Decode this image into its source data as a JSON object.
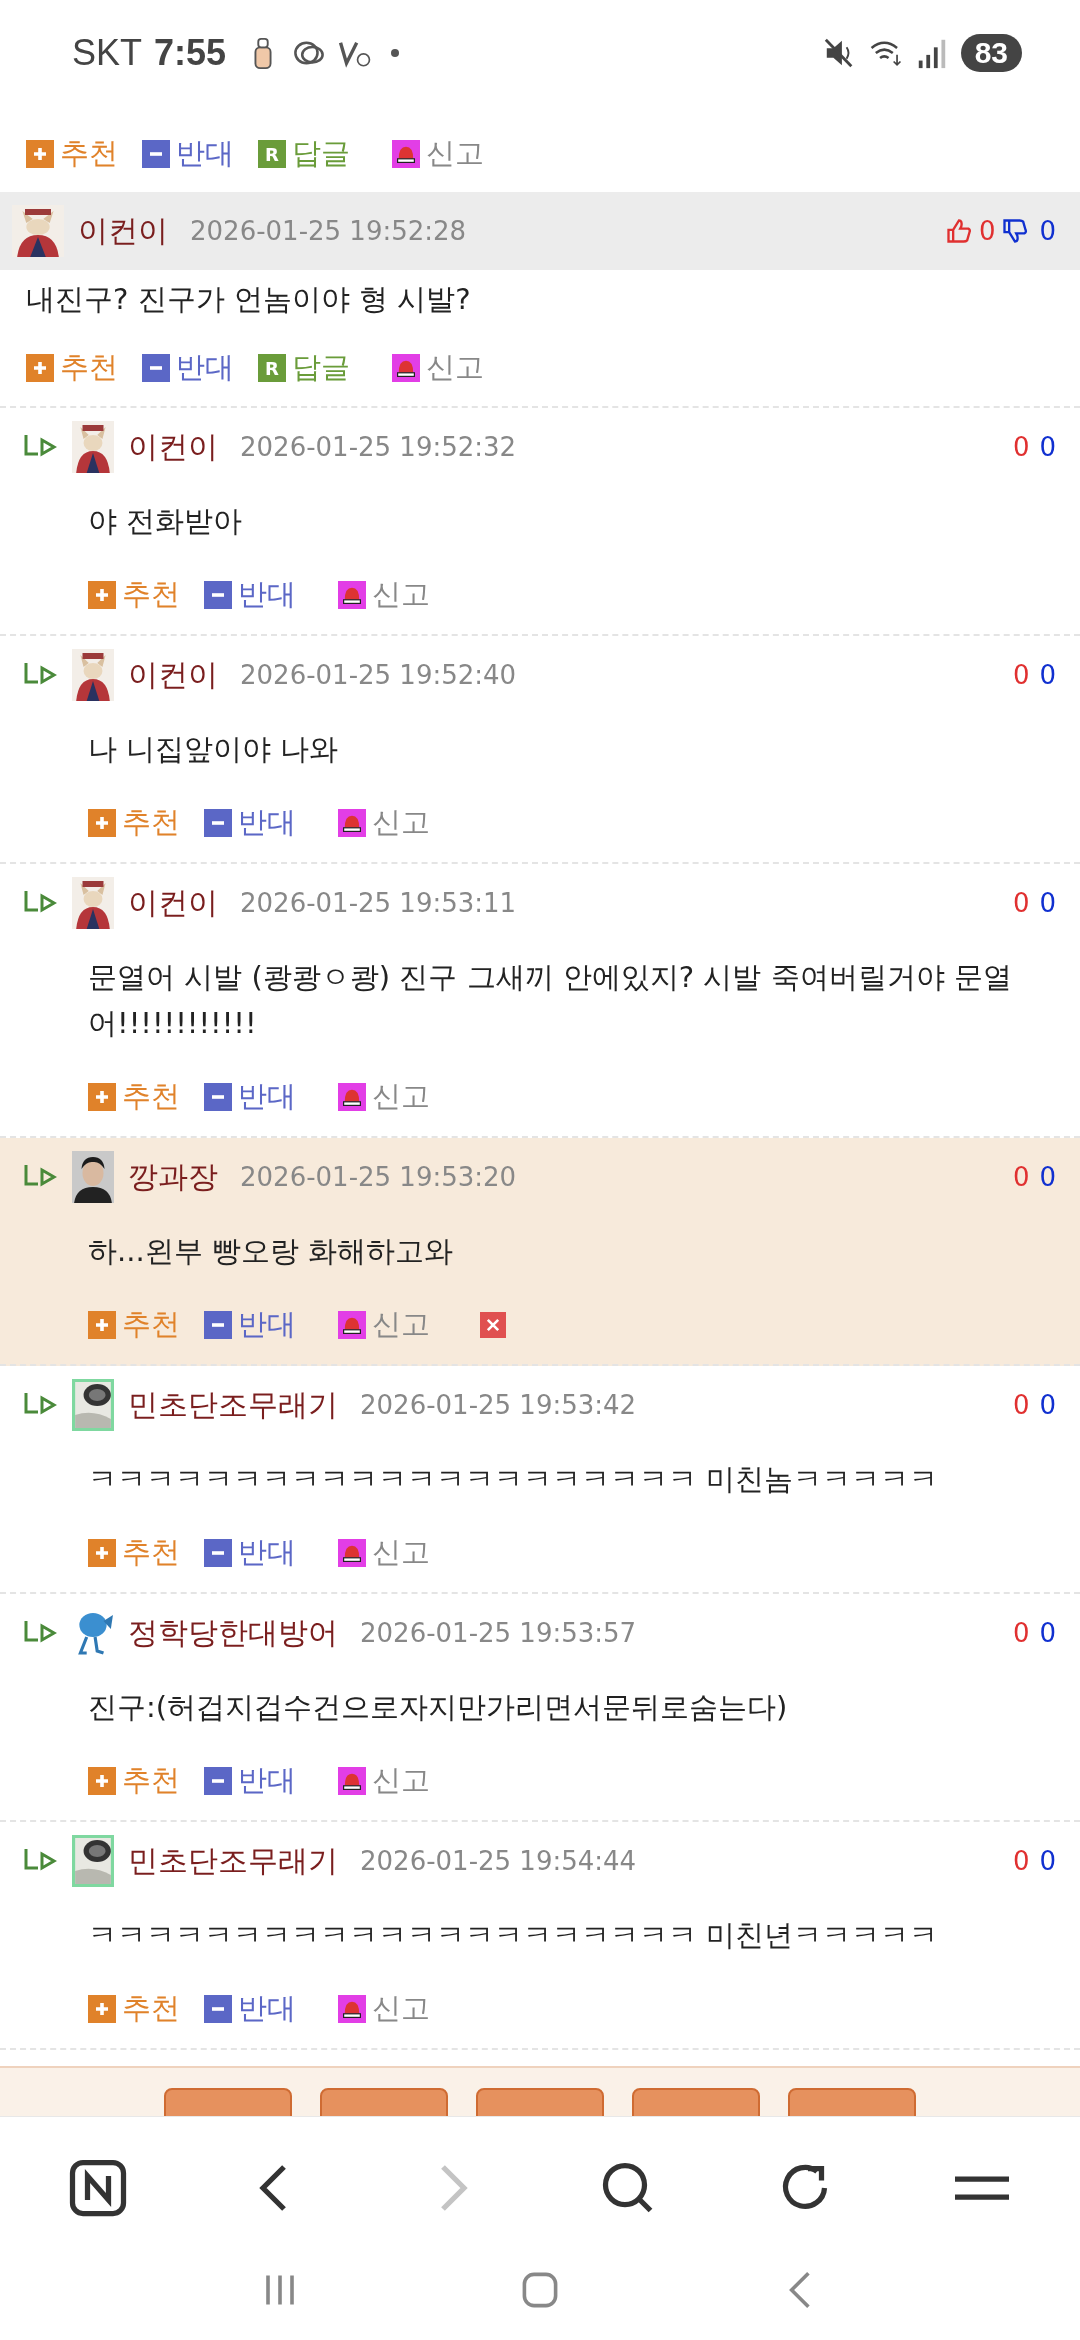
{
  "status_bar": {
    "carrier": "SKT",
    "time": "7:55",
    "battery": "83"
  },
  "top_actions": [
    {
      "kind": "recommend",
      "label": "추천"
    },
    {
      "kind": "oppose",
      "label": "반대"
    },
    {
      "kind": "reply",
      "label": "답글",
      "icon_text": "R"
    },
    {
      "kind": "report",
      "label": "신고"
    }
  ],
  "comments": [
    {
      "kind": "comment",
      "author": "이컨이",
      "date": "2026-01-25 19:52:28",
      "up": "0",
      "down": "0",
      "body": "내진구? 진구가 언놈이야 형 시발?",
      "highlighted": false,
      "deletable": false,
      "actions": [
        {
          "kind": "recommend",
          "label": "추천"
        },
        {
          "kind": "oppose",
          "label": "반대"
        },
        {
          "kind": "reply",
          "label": "답글",
          "icon_text": "R"
        },
        {
          "kind": "report",
          "label": "신고"
        }
      ]
    },
    {
      "kind": "reply",
      "author": "이컨이",
      "date": "2026-01-25 19:52:32",
      "up": "0",
      "down": "0",
      "body": "야 전화받아",
      "highlighted": false,
      "deletable": false,
      "actions": [
        {
          "kind": "recommend",
          "label": "추천"
        },
        {
          "kind": "oppose",
          "label": "반대"
        },
        {
          "kind": "report",
          "label": "신고"
        }
      ]
    },
    {
      "kind": "reply",
      "author": "이컨이",
      "date": "2026-01-25 19:52:40",
      "up": "0",
      "down": "0",
      "body": "나 니집앞이야 나와",
      "highlighted": false,
      "deletable": false,
      "actions": [
        {
          "kind": "recommend",
          "label": "추천"
        },
        {
          "kind": "oppose",
          "label": "반대"
        },
        {
          "kind": "report",
          "label": "신고"
        }
      ]
    },
    {
      "kind": "reply",
      "author": "이컨이",
      "date": "2026-01-25 19:53:11",
      "up": "0",
      "down": "0",
      "body": "문열어 시발 (쾅쾅ㅇ쾅) 진구 그새끼 안에있지? 시발 죽여버릴거야 문열어!!!!!!!!!!!!",
      "highlighted": false,
      "deletable": false,
      "actions": [
        {
          "kind": "recommend",
          "label": "추천"
        },
        {
          "kind": "oppose",
          "label": "반대"
        },
        {
          "kind": "report",
          "label": "신고"
        }
      ]
    },
    {
      "kind": "reply",
      "author": "깡과장",
      "date": "2026-01-25 19:53:20",
      "up": "0",
      "down": "0",
      "body": "하...왼부 빵오랑 화해하고와",
      "highlighted": true,
      "deletable": true,
      "actions": [
        {
          "kind": "recommend",
          "label": "추천"
        },
        {
          "kind": "oppose",
          "label": "반대"
        },
        {
          "kind": "report",
          "label": "신고"
        }
      ]
    },
    {
      "kind": "reply",
      "author": "민초단조무래기",
      "date": "2026-01-25 19:53:42",
      "up": "0",
      "down": "0",
      "body": "ㅋㅋㅋㅋㅋㅋㅋㅋㅋㅋㅋㅋㅋㅋㅋㅋㅋㅋㅋㅋㅋ 미친놈ㅋㅋㅋㅋㅋ",
      "highlighted": false,
      "deletable": false,
      "actions": [
        {
          "kind": "recommend",
          "label": "추천"
        },
        {
          "kind": "oppose",
          "label": "반대"
        },
        {
          "kind": "report",
          "label": "신고"
        }
      ]
    },
    {
      "kind": "reply",
      "author": "정학당한대방어",
      "date": "2026-01-25 19:53:57",
      "up": "0",
      "down": "0",
      "body": "진구:(허겁지겁수건으로자지만가리면서문뒤로숨는다)",
      "highlighted": false,
      "deletable": false,
      "actions": [
        {
          "kind": "recommend",
          "label": "추천"
        },
        {
          "kind": "oppose",
          "label": "반대"
        },
        {
          "kind": "report",
          "label": "신고"
        }
      ]
    },
    {
      "kind": "reply",
      "author": "민초단조무래기",
      "date": "2026-01-25 19:54:44",
      "up": "0",
      "down": "0",
      "body": "ㅋㅋㅋㅋㅋㅋㅋㅋㅋㅋㅋㅋㅋㅋㅋㅋㅋㅋㅋㅋㅋ 미친년ㅋㅋㅋㅋㅋ",
      "highlighted": false,
      "deletable": false,
      "actions": [
        {
          "kind": "recommend",
          "label": "추천"
        },
        {
          "kind": "oppose",
          "label": "반대"
        },
        {
          "kind": "report",
          "label": "신고"
        }
      ]
    }
  ],
  "browser_toolbar": {
    "forward_enabled": false
  }
}
